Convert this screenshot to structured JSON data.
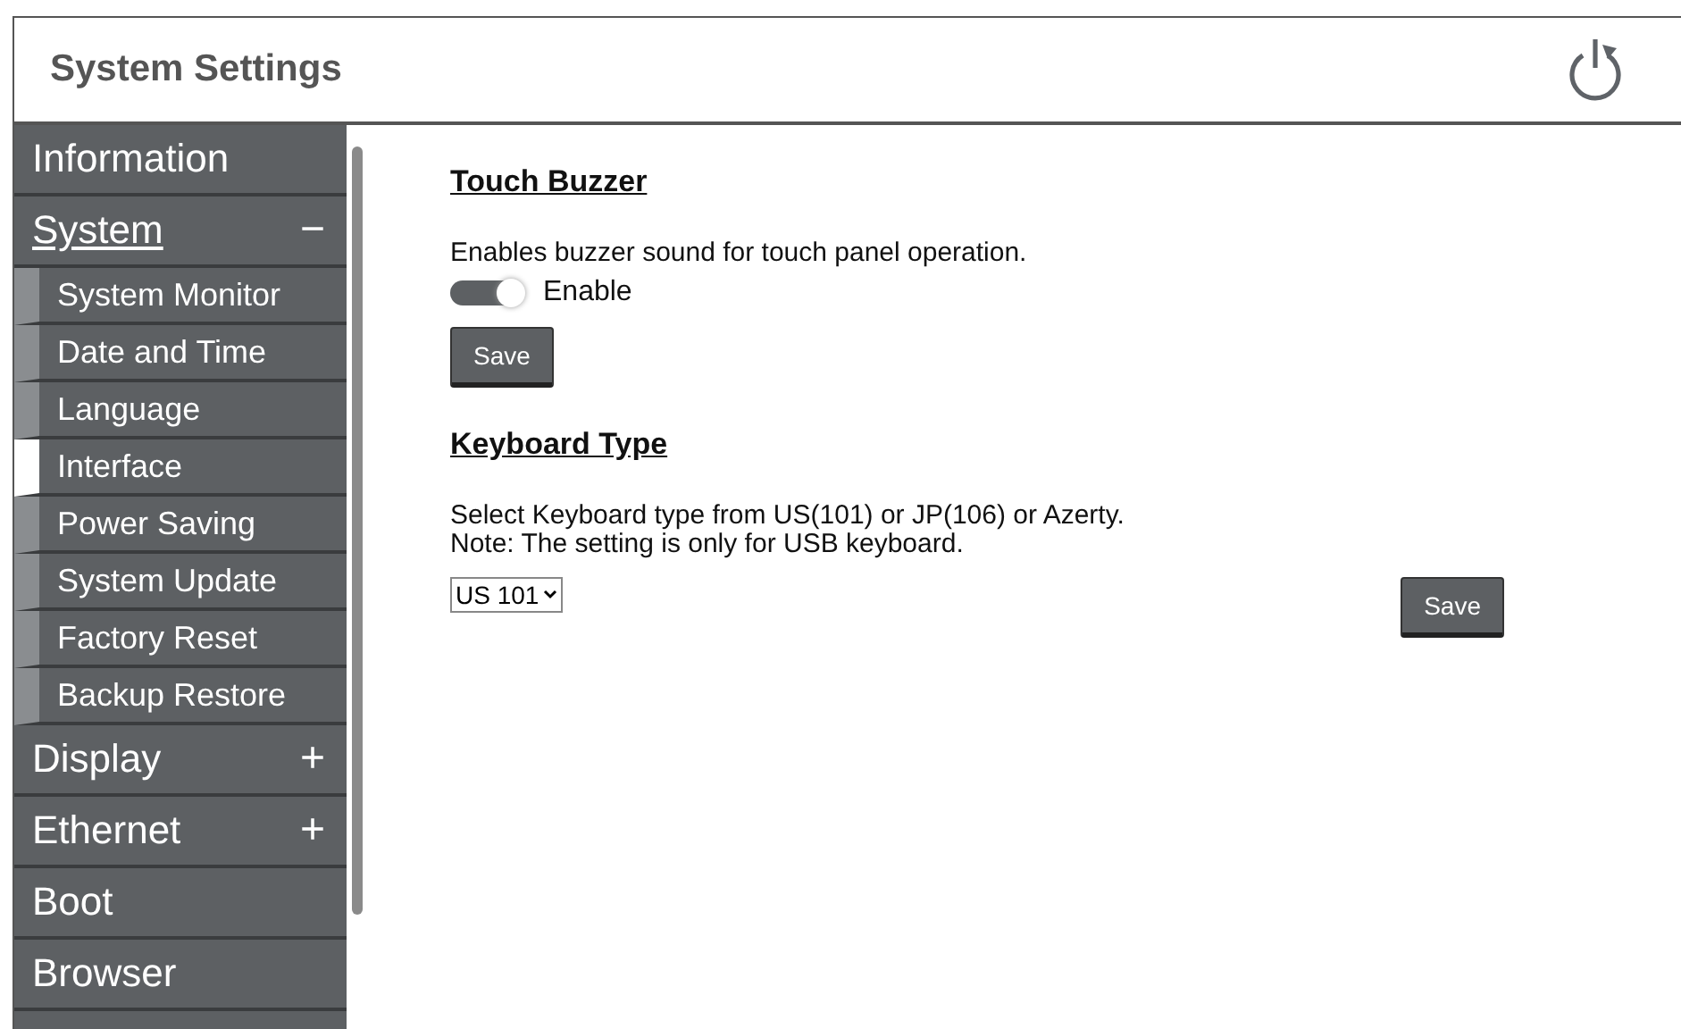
{
  "header": {
    "title": "System Settings"
  },
  "sidebar": {
    "items": [
      {
        "label": "Information",
        "selected": false
      },
      {
        "label": "System",
        "selected": true,
        "sign": "−",
        "children": [
          {
            "label": "System Monitor",
            "selected": false
          },
          {
            "label": "Date and Time",
            "selected": false
          },
          {
            "label": "Language",
            "selected": false
          },
          {
            "label": "Interface",
            "selected": true
          },
          {
            "label": "Power Saving",
            "selected": false
          },
          {
            "label": "System Update",
            "selected": false
          },
          {
            "label": "Factory Reset",
            "selected": false
          },
          {
            "label": "Backup Restore",
            "selected": false
          }
        ]
      },
      {
        "label": "Display",
        "selected": false,
        "sign": "+"
      },
      {
        "label": "Ethernet",
        "selected": false,
        "sign": "+"
      },
      {
        "label": "Boot",
        "selected": false
      },
      {
        "label": "Browser",
        "selected": false
      }
    ]
  },
  "sections": [
    {
      "title": "Touch Buzzer",
      "description": [
        "Enables buzzer sound for touch panel operation."
      ],
      "toggle": {
        "label": "Enable",
        "on": true
      },
      "save": "Save",
      "kind": "toggle"
    },
    {
      "title": "Keyboard Type",
      "description": [
        "Select Keyboard type from US(101) or JP(106) or Azerty.",
        "Note: The setting is only for USB keyboard."
      ],
      "select": {
        "value": "US 101"
      },
      "save": "Save",
      "kind": "select"
    }
  ]
}
